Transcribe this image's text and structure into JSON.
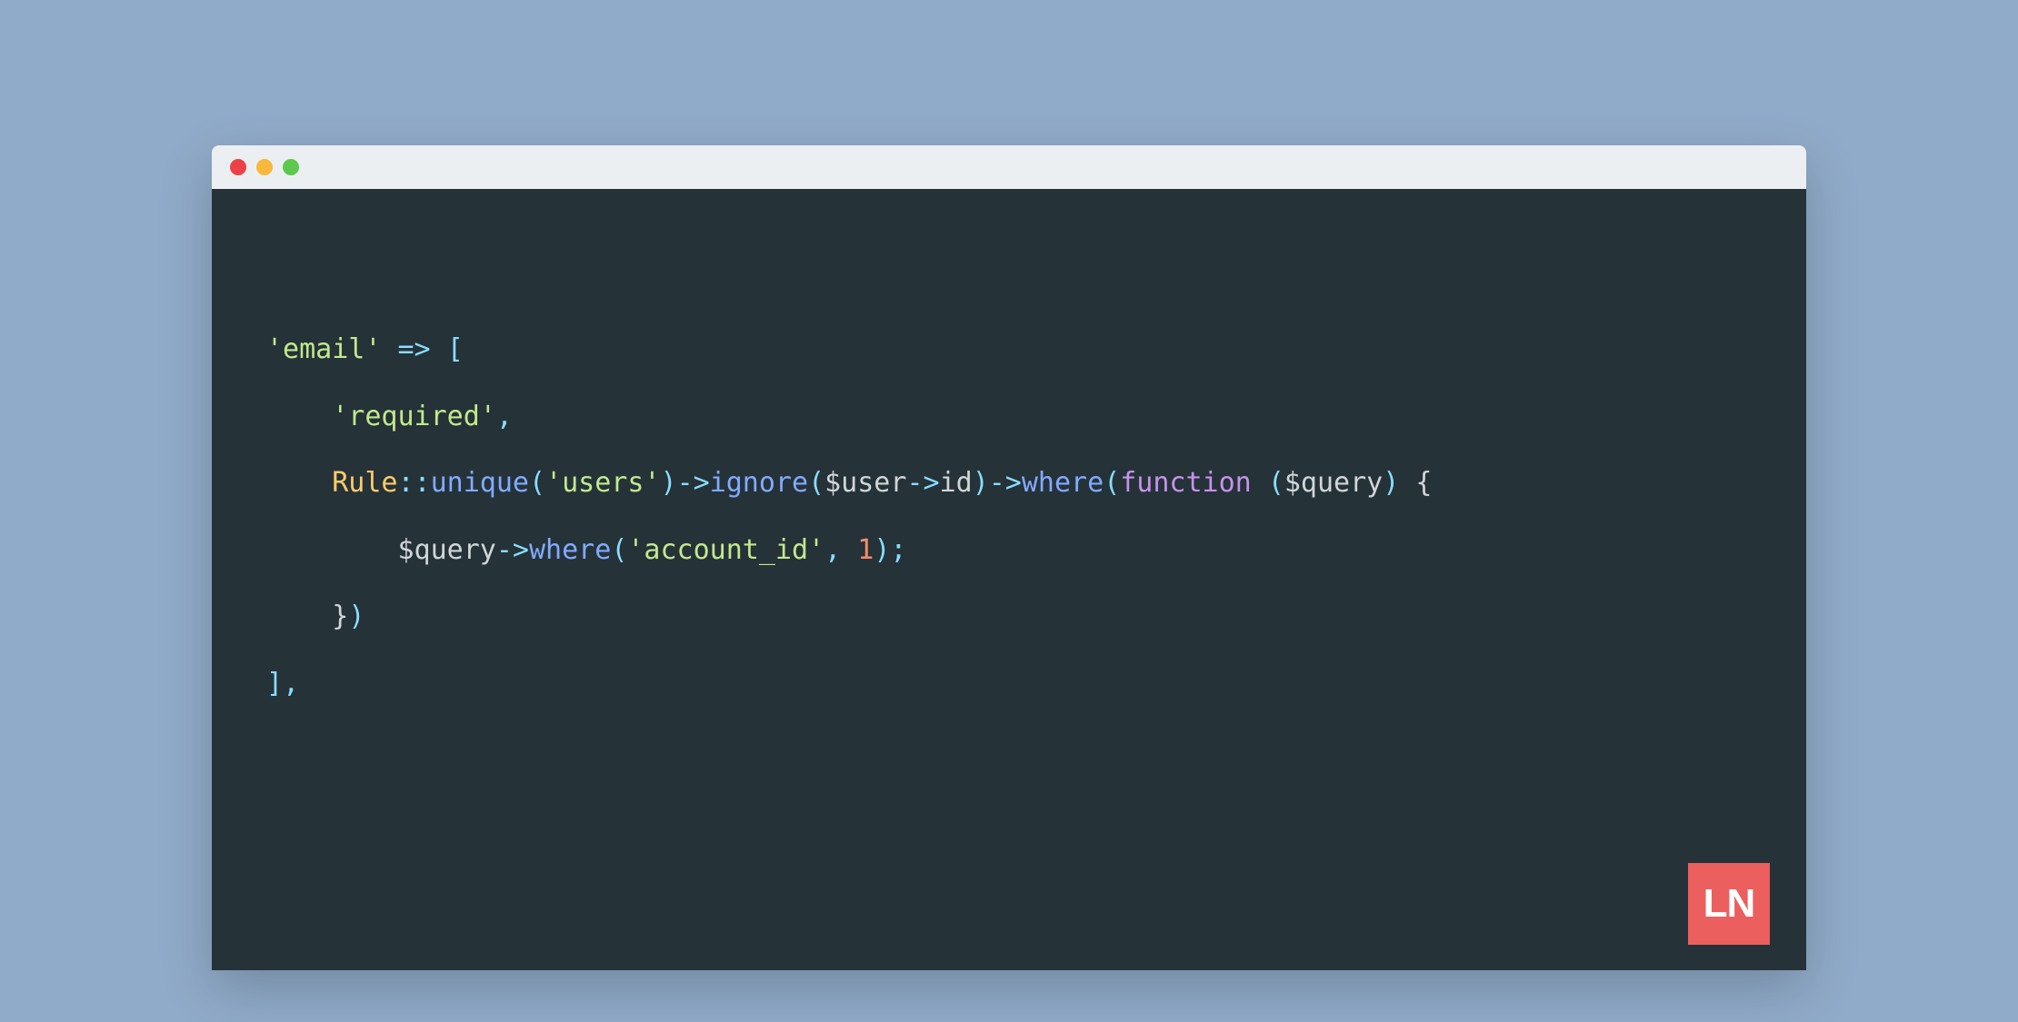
{
  "window": {
    "traffic_lights": [
      "close",
      "minimize",
      "zoom"
    ]
  },
  "code": {
    "indent1": "",
    "indent2": "    ",
    "indent3": "        ",
    "line1": {
      "str_email": "'email'",
      "arrow": " => ",
      "bracket": "["
    },
    "line2": {
      "str_required": "'required'",
      "comma": ","
    },
    "line3": {
      "cls_rule": "Rule",
      "scope": "::",
      "m_unique": "unique",
      "p_open1": "(",
      "str_users": "'users'",
      "p_close1": ")",
      "arrow1": "->",
      "m_ignore": "ignore",
      "p_open2": "(",
      "var_user": "$user",
      "arrow2": "->",
      "prop_id": "id",
      "p_close2": ")",
      "arrow3": "->",
      "m_where": "where",
      "p_open3": "(",
      "kw_function": "function",
      "space": " ",
      "p_open4": "(",
      "var_query": "$query",
      "p_close4": ")",
      "space2": " ",
      "brace_open": "{"
    },
    "line4": {
      "var_query": "$query",
      "arrow": "->",
      "m_where": "where",
      "p_open": "(",
      "str_account": "'account_id'",
      "comma_sp": ", ",
      "num_1": "1",
      "p_close": ")",
      "semi": ";"
    },
    "line5": {
      "brace_close": "}",
      "p_close": ")"
    },
    "line6": {
      "bracket_close": "]",
      "comma": ","
    }
  },
  "logo": {
    "text": "LN"
  }
}
